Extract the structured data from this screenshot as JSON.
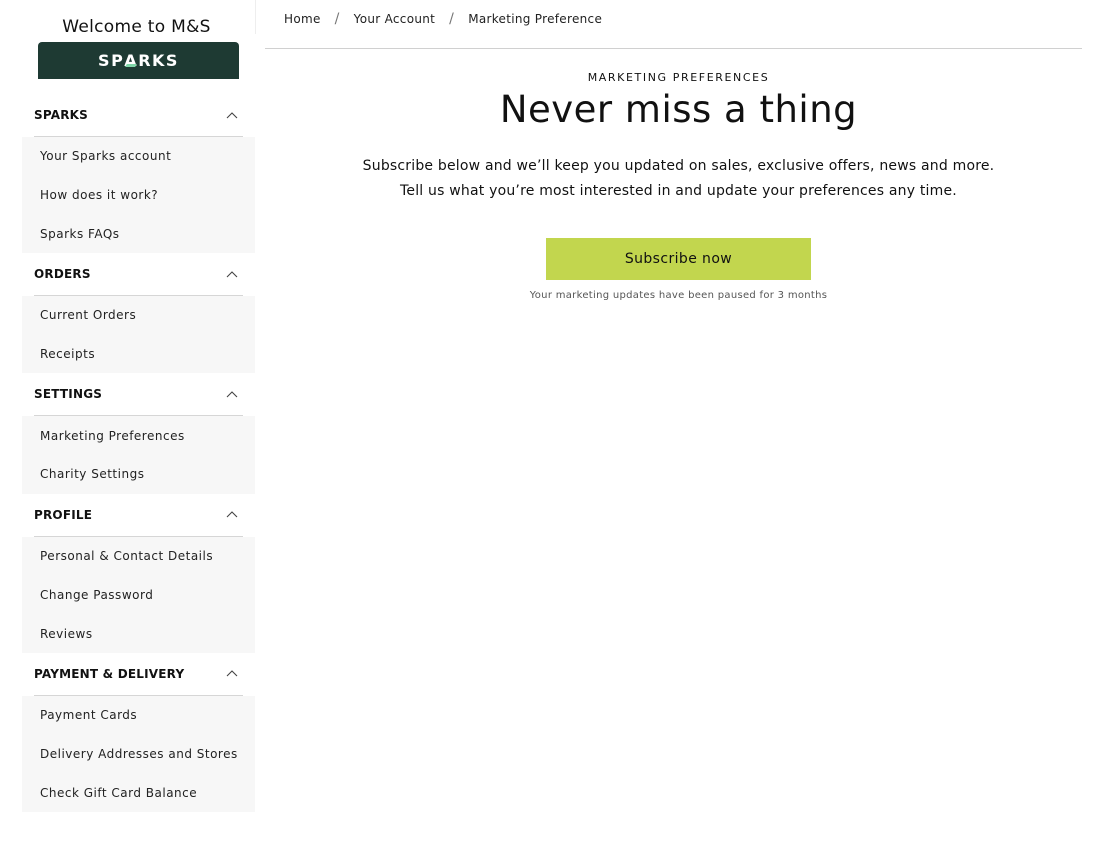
{
  "sidebar": {
    "welcome": "Welcome to M&S",
    "logo": {
      "pre": "SP",
      "a": "A",
      "post": "RKS",
      "bg_color": "#1e3a33",
      "accent_color": "#7fd6a8"
    },
    "sections": [
      {
        "title": "SPARKS",
        "icon": "chevron-up-icon",
        "items": [
          "Your Sparks account",
          "How does it work?",
          "Sparks FAQs"
        ]
      },
      {
        "title": "ORDERS",
        "icon": "chevron-up-icon",
        "items": [
          "Current Orders",
          "Receipts"
        ]
      },
      {
        "title": "SETTINGS",
        "icon": "chevron-up-icon",
        "items": [
          "Marketing Preferences",
          "Charity Settings"
        ]
      },
      {
        "title": "PROFILE",
        "icon": "chevron-up-icon",
        "items": [
          "Personal & Contact Details",
          "Change Password",
          "Reviews"
        ]
      },
      {
        "title": "PAYMENT & DELIVERY",
        "icon": "chevron-up-icon",
        "items": [
          "Payment Cards",
          "Delivery Addresses and Stores",
          "Check Gift Card Balance"
        ]
      }
    ]
  },
  "breadcrumb": {
    "items": [
      "Home",
      "Your Account",
      "Marketing Preference"
    ],
    "separator": "/"
  },
  "main": {
    "eyebrow": "MARKETING PREFERENCES",
    "headline": "Never miss a thing",
    "desc_line1": "Subscribe below and we’ll keep you updated on sales, exclusive offers, news and more.",
    "desc_line2": "Tell us what you’re most interested in and update your preferences any time.",
    "subscribe_label": "Subscribe now",
    "subscribe_color": "#c2d64e",
    "note": "Your marketing updates have been paused for 3 months"
  }
}
